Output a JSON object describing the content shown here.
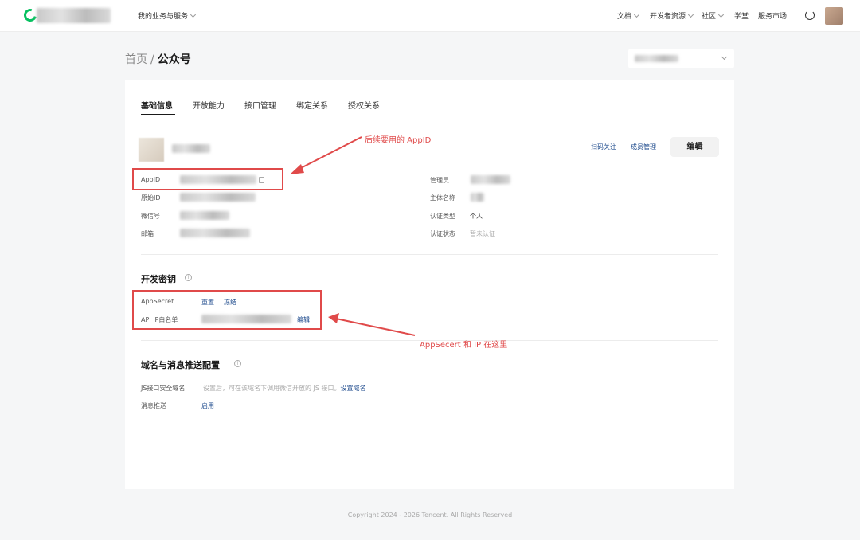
{
  "topbar": {
    "service_menu": "我的业务与服务",
    "nav": [
      "文档",
      "开发者资源",
      "社区",
      "学堂",
      "服务市场"
    ]
  },
  "breadcrumb": {
    "home": "首页",
    "separator": "/",
    "current": "公众号"
  },
  "tabs": [
    "基础信息",
    "开放能力",
    "接口管理",
    "绑定关系",
    "授权关系"
  ],
  "account_actions": {
    "scan_follow": "扫码关注",
    "members": "成员管理",
    "edit": "编辑"
  },
  "basic_info": {
    "left_labels": [
      "AppID",
      "原始ID",
      "微信号",
      "邮箱"
    ],
    "right_labels": [
      "管理员",
      "主体名称",
      "认证类型",
      "认证状态"
    ],
    "auth_type_value": "个人",
    "auth_status_value": "暂未认证"
  },
  "dev_key": {
    "title": "开发密钥",
    "appsecret_label": "AppSecret",
    "reset": "重置",
    "freeze": "冻结",
    "ip_label": "API IP白名单",
    "ip_edit": "编辑"
  },
  "domain_config": {
    "title": "域名与消息推送配置",
    "js_label": "JS接口安全域名",
    "js_hint": "设置后，可在该域名下调用微信开放的 JS 接口。",
    "js_link": "设置域名",
    "push_label": "消息推送",
    "push_link": "启用"
  },
  "annotations": {
    "appid_note": "后续要用的 AppID",
    "secret_note": "AppSecert 和 IP 在这里",
    "color": "#e04a4a"
  },
  "footer": "Copyright 2024 - 2026 Tencent. All Rights Reserved"
}
